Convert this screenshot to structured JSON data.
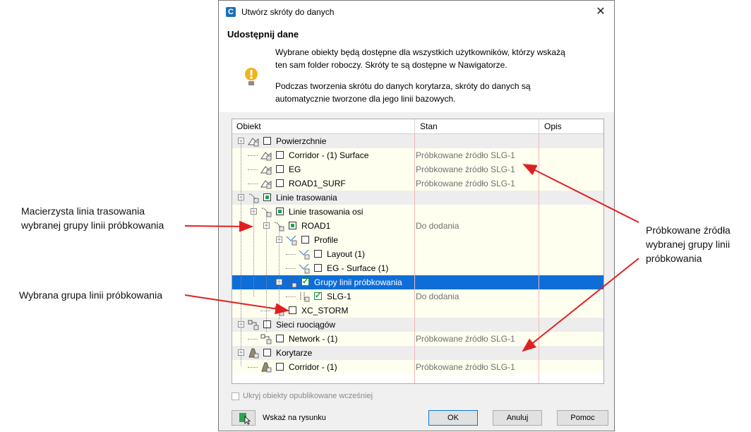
{
  "dialog": {
    "title": "Utwórz skróty do danych",
    "close_icon": "close-icon",
    "header_title": "Udostępnij dane",
    "info_line1": "Wybrane obiekty będą dostępne dla wszystkich użytkowników, którzy wskażą",
    "info_line2": "ten sam folder roboczy. Skróty te są dostępne w Nawigatorze.",
    "info_line3": "Podczas tworzenia skrótu do danych korytarza, skróty do danych są",
    "info_line4": "automatycznie tworzone dla jego linii bazowych."
  },
  "tree": {
    "columns": [
      "Obiekt",
      "Stan",
      "Opis"
    ],
    "rows": [
      {
        "label": "Powierzchnie",
        "status": "",
        "check": "unchecked",
        "icon": "surface-icon"
      },
      {
        "label": "Corridor - (1) Surface",
        "status": "Próbkowane źródło SLG-1",
        "check": "unchecked",
        "icon": "surface-icon"
      },
      {
        "label": "EG",
        "status": "Próbkowane źródło SLG-1",
        "check": "unchecked",
        "icon": "surface-icon"
      },
      {
        "label": "ROAD1_SURF",
        "status": "Próbkowane źródło SLG-1",
        "check": "unchecked",
        "icon": "surface-icon"
      },
      {
        "label": "Linie trasowania",
        "status": "",
        "check": "partial",
        "icon": "alignment-icon"
      },
      {
        "label": "Linie trasowania osi",
        "status": "",
        "check": "partial",
        "icon": "alignment-icon"
      },
      {
        "label": "ROAD1",
        "status": "Do dodania",
        "check": "partial",
        "icon": "alignment-icon"
      },
      {
        "label": "Profile",
        "status": "",
        "check": "unchecked",
        "icon": "profile-icon"
      },
      {
        "label": "Layout (1)",
        "status": "",
        "check": "unchecked",
        "icon": "profile-icon"
      },
      {
        "label": "EG - Surface (1)",
        "status": "",
        "check": "unchecked",
        "icon": "profile-icon"
      },
      {
        "label": "Grupy linii próbkowania",
        "status": "",
        "check": "checked",
        "icon": "sample-lines-icon"
      },
      {
        "label": "SLG-1",
        "status": "Do dodania",
        "check": "checked",
        "icon": "sample-lines-icon"
      },
      {
        "label": "XC_STORM",
        "status": "",
        "check": "unchecked",
        "icon": "alignment-icon"
      },
      {
        "label": "Sieci ruociągów",
        "status": "",
        "check": "unchecked",
        "icon": "pipe-network-icon"
      },
      {
        "label": "Network - (1)",
        "status": "Próbkowane źródło SLG-1",
        "check": "unchecked",
        "icon": "pipe-network-icon"
      },
      {
        "label": "Korytarze",
        "status": "",
        "check": "unchecked",
        "icon": "corridor-icon"
      },
      {
        "label": "Corridor - (1)",
        "status": "Próbkowane źródło SLG-1",
        "check": "unchecked",
        "icon": "corridor-icon"
      }
    ]
  },
  "footer": {
    "hide_published_label": "Ukryj obiekty opublikowane wcześniej",
    "pick_label": "Wskaż na rysunku",
    "ok_label": "OK",
    "cancel_label": "Anuluj",
    "help_label": "Pomoc"
  },
  "annotations": {
    "left1_line1": "Macierzysta linia trasowania",
    "left1_line2": "wybranej grupy linii próbkowania",
    "left2": "Wybrana grupa linii próbkowania",
    "right_line1": "Próbkowane źródła",
    "right_line2": "wybranej grupy linii",
    "right_line3": "próbkowania"
  },
  "colors": {
    "selection": "#0f6dd8",
    "leaf_row": "#fffff0",
    "arrow": "#e02020"
  }
}
